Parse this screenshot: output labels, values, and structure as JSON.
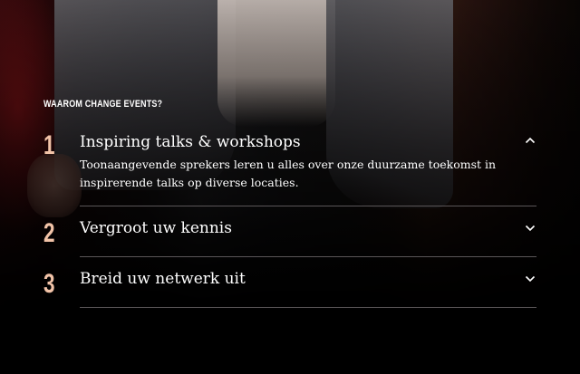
{
  "section": {
    "eyebrow": "WAAROM CHANGE EVENTS?"
  },
  "accordion": {
    "items": [
      {
        "number": "1",
        "title": "Inspiring talks & workshops",
        "description": "Toonaangevende sprekers leren u alles over onze duurzame toekomst in inspirerende talks op diverse locaties.",
        "expanded": true,
        "icon": "chevron-up-icon"
      },
      {
        "number": "2",
        "title": "Vergroot uw kennis",
        "expanded": false,
        "icon": "chevron-down-icon"
      },
      {
        "number": "3",
        "title": "Breid uw netwerk uit",
        "expanded": false,
        "icon": "chevron-down-icon"
      }
    ]
  },
  "colors": {
    "number_accent": "#f2c3a8",
    "text": "#ffffff",
    "divider": "#5a5658"
  }
}
